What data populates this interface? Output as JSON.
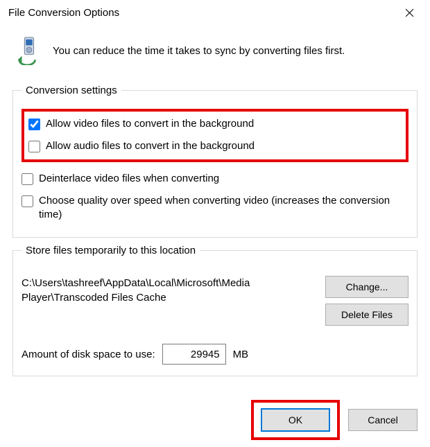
{
  "window": {
    "title": "File Conversion Options"
  },
  "intro": "You can reduce the time it takes to sync by converting files first.",
  "conversion": {
    "legend": "Conversion settings",
    "allow_video": "Allow video files to convert in the background",
    "allow_audio": "Allow audio files to convert in the background",
    "deinterlace": "Deinterlace video files when converting",
    "quality_over_speed": "Choose quality over speed when converting video (increases the conversion time)"
  },
  "store": {
    "legend": "Store files temporarily to this location",
    "path": "C:\\Users\\tashreef\\AppData\\Local\\Microsoft\\Media Player\\Transcoded Files Cache",
    "change": "Change...",
    "delete": "Delete Files",
    "disk_label": "Amount of disk space to use:",
    "disk_value": "29945",
    "disk_unit": "MB"
  },
  "buttons": {
    "ok": "OK",
    "cancel": "Cancel"
  },
  "checked": {
    "allow_video": true,
    "allow_audio": false,
    "deinterlace": false,
    "quality_over_speed": false
  }
}
